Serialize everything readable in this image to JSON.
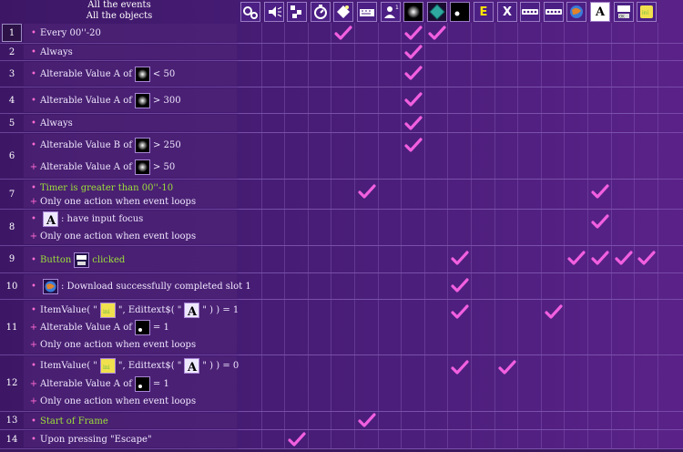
{
  "header": {
    "line1": "All the events",
    "line2": "All the objects"
  },
  "objects": [
    {
      "name": "special-conditions-icon"
    },
    {
      "name": "sound-icon"
    },
    {
      "name": "storyboard-icon"
    },
    {
      "name": "timer-icon"
    },
    {
      "name": "create-objects-icon"
    },
    {
      "name": "keyboard-mouse-icon"
    },
    {
      "name": "player-icon"
    },
    {
      "name": "glow-active-icon"
    },
    {
      "name": "diamond-active-icon"
    },
    {
      "name": "dot-active-icon"
    },
    {
      "name": "e-icon",
      "glyph": "E"
    },
    {
      "name": "x-icon",
      "glyph": "X"
    },
    {
      "name": "dotted-string-icon-1"
    },
    {
      "name": "dotted-string-icon-2"
    },
    {
      "name": "download-globe-icon"
    },
    {
      "name": "text-a-icon",
      "glyph": "A"
    },
    {
      "name": "button-object-icon"
    },
    {
      "name": "ini-file-icon"
    }
  ],
  "events": [
    {
      "num": "1",
      "selected": true,
      "lines": [
        {
          "b": "•",
          "t": "Every 00''-20"
        }
      ],
      "checks": [
        4,
        7,
        8
      ]
    },
    {
      "num": "2",
      "lines": [
        {
          "b": "•",
          "t": "Always"
        }
      ],
      "checks": [
        7
      ]
    },
    {
      "num": "3",
      "lines": [
        {
          "b": "•",
          "pre": "Alterable Value A of",
          "icon": "glow",
          "post": "< 50"
        }
      ],
      "checks": [
        7
      ]
    },
    {
      "num": "4",
      "lines": [
        {
          "b": "•",
          "pre": "Alterable Value A of",
          "icon": "glow",
          "post": "> 300"
        }
      ],
      "checks": [
        7
      ]
    },
    {
      "num": "5",
      "lines": [
        {
          "b": "•",
          "t": "Always"
        }
      ],
      "checks": [
        7
      ]
    },
    {
      "num": "6",
      "lines": [
        {
          "b": "•",
          "pre": "Alterable Value B of",
          "icon": "glow",
          "post": "> 250"
        },
        {
          "b": "+",
          "pre": "Alterable Value A of",
          "icon": "glow",
          "post": "> 50"
        }
      ],
      "checks": [
        7
      ]
    },
    {
      "num": "7",
      "lines": [
        {
          "b": "•",
          "t": "Timer is greater than 00''-10",
          "green": true
        },
        {
          "b": "+",
          "t": "Only one action when event loops"
        }
      ],
      "checks": [
        5,
        15
      ]
    },
    {
      "num": "8",
      "lines": [
        {
          "b": "•",
          "icon": "A",
          "post": ": have input focus"
        },
        {
          "b": "+",
          "t": "Only one action when event loops"
        }
      ],
      "checks": [
        15
      ]
    },
    {
      "num": "9",
      "lines": [
        {
          "b": "•",
          "pre": "Button",
          "icon": "btn",
          "post": "clicked",
          "green": true
        }
      ],
      "checks": [
        9,
        14,
        15,
        16,
        17
      ]
    },
    {
      "num": "10",
      "lines": [
        {
          "b": "•",
          "icon": "globe",
          "post": ": Download successfully completed slot 1"
        }
      ],
      "checks": [
        9
      ]
    },
    {
      "num": "11",
      "lines": [
        {
          "b": "•",
          "pre": "ItemValue( \"",
          "icon": "ini",
          "mid": "\", Edittext$( \"",
          "icon2": "A",
          "post": "\" ) ) = 1"
        },
        {
          "b": "+",
          "pre": "Alterable Value A of",
          "icon": "dot",
          "post": "= 1"
        },
        {
          "b": "+",
          "t": "Only one action when event loops"
        }
      ],
      "checks": [
        9,
        13
      ]
    },
    {
      "num": "12",
      "lines": [
        {
          "b": "•",
          "pre": "ItemValue( \"",
          "icon": "ini",
          "mid": "\", Edittext$( \"",
          "icon2": "A",
          "post": "\" ) ) = 0"
        },
        {
          "b": "+",
          "pre": "Alterable Value A of",
          "icon": "dot",
          "post": "= 1"
        },
        {
          "b": "+",
          "t": "Only one action when event loops"
        }
      ],
      "checks": [
        9,
        11
      ]
    },
    {
      "num": "13",
      "lines": [
        {
          "b": "•",
          "t": "Start of Frame",
          "green": true
        }
      ],
      "checks": [
        5
      ]
    },
    {
      "num": "14",
      "lines": [
        {
          "b": "•",
          "t": "Upon pressing \"Escape\""
        }
      ],
      "checks": [
        2
      ]
    }
  ],
  "colors": {
    "check": "#f25fe0",
    "accent": "#5a2288"
  }
}
